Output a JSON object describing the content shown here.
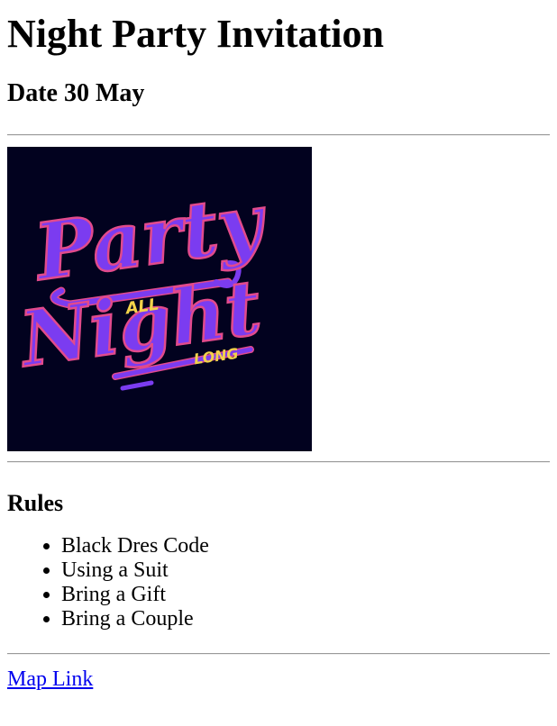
{
  "header": {
    "title": "Night Party Invitation",
    "date": "Date 30 May"
  },
  "poster": {
    "line1": "Party",
    "line2": "Night",
    "small1": "ALL",
    "small2": "LONG",
    "colors": {
      "background": "#02021f",
      "script": "#7b3cf0",
      "outline": "#e24a8c",
      "accent": "#f2d34a"
    }
  },
  "rules": {
    "heading": "Rules",
    "items": [
      "Black Dres Code",
      "Using a Suit",
      "Bring a Gift",
      "Bring a Couple"
    ]
  },
  "footer": {
    "map_link": "Map Link"
  }
}
